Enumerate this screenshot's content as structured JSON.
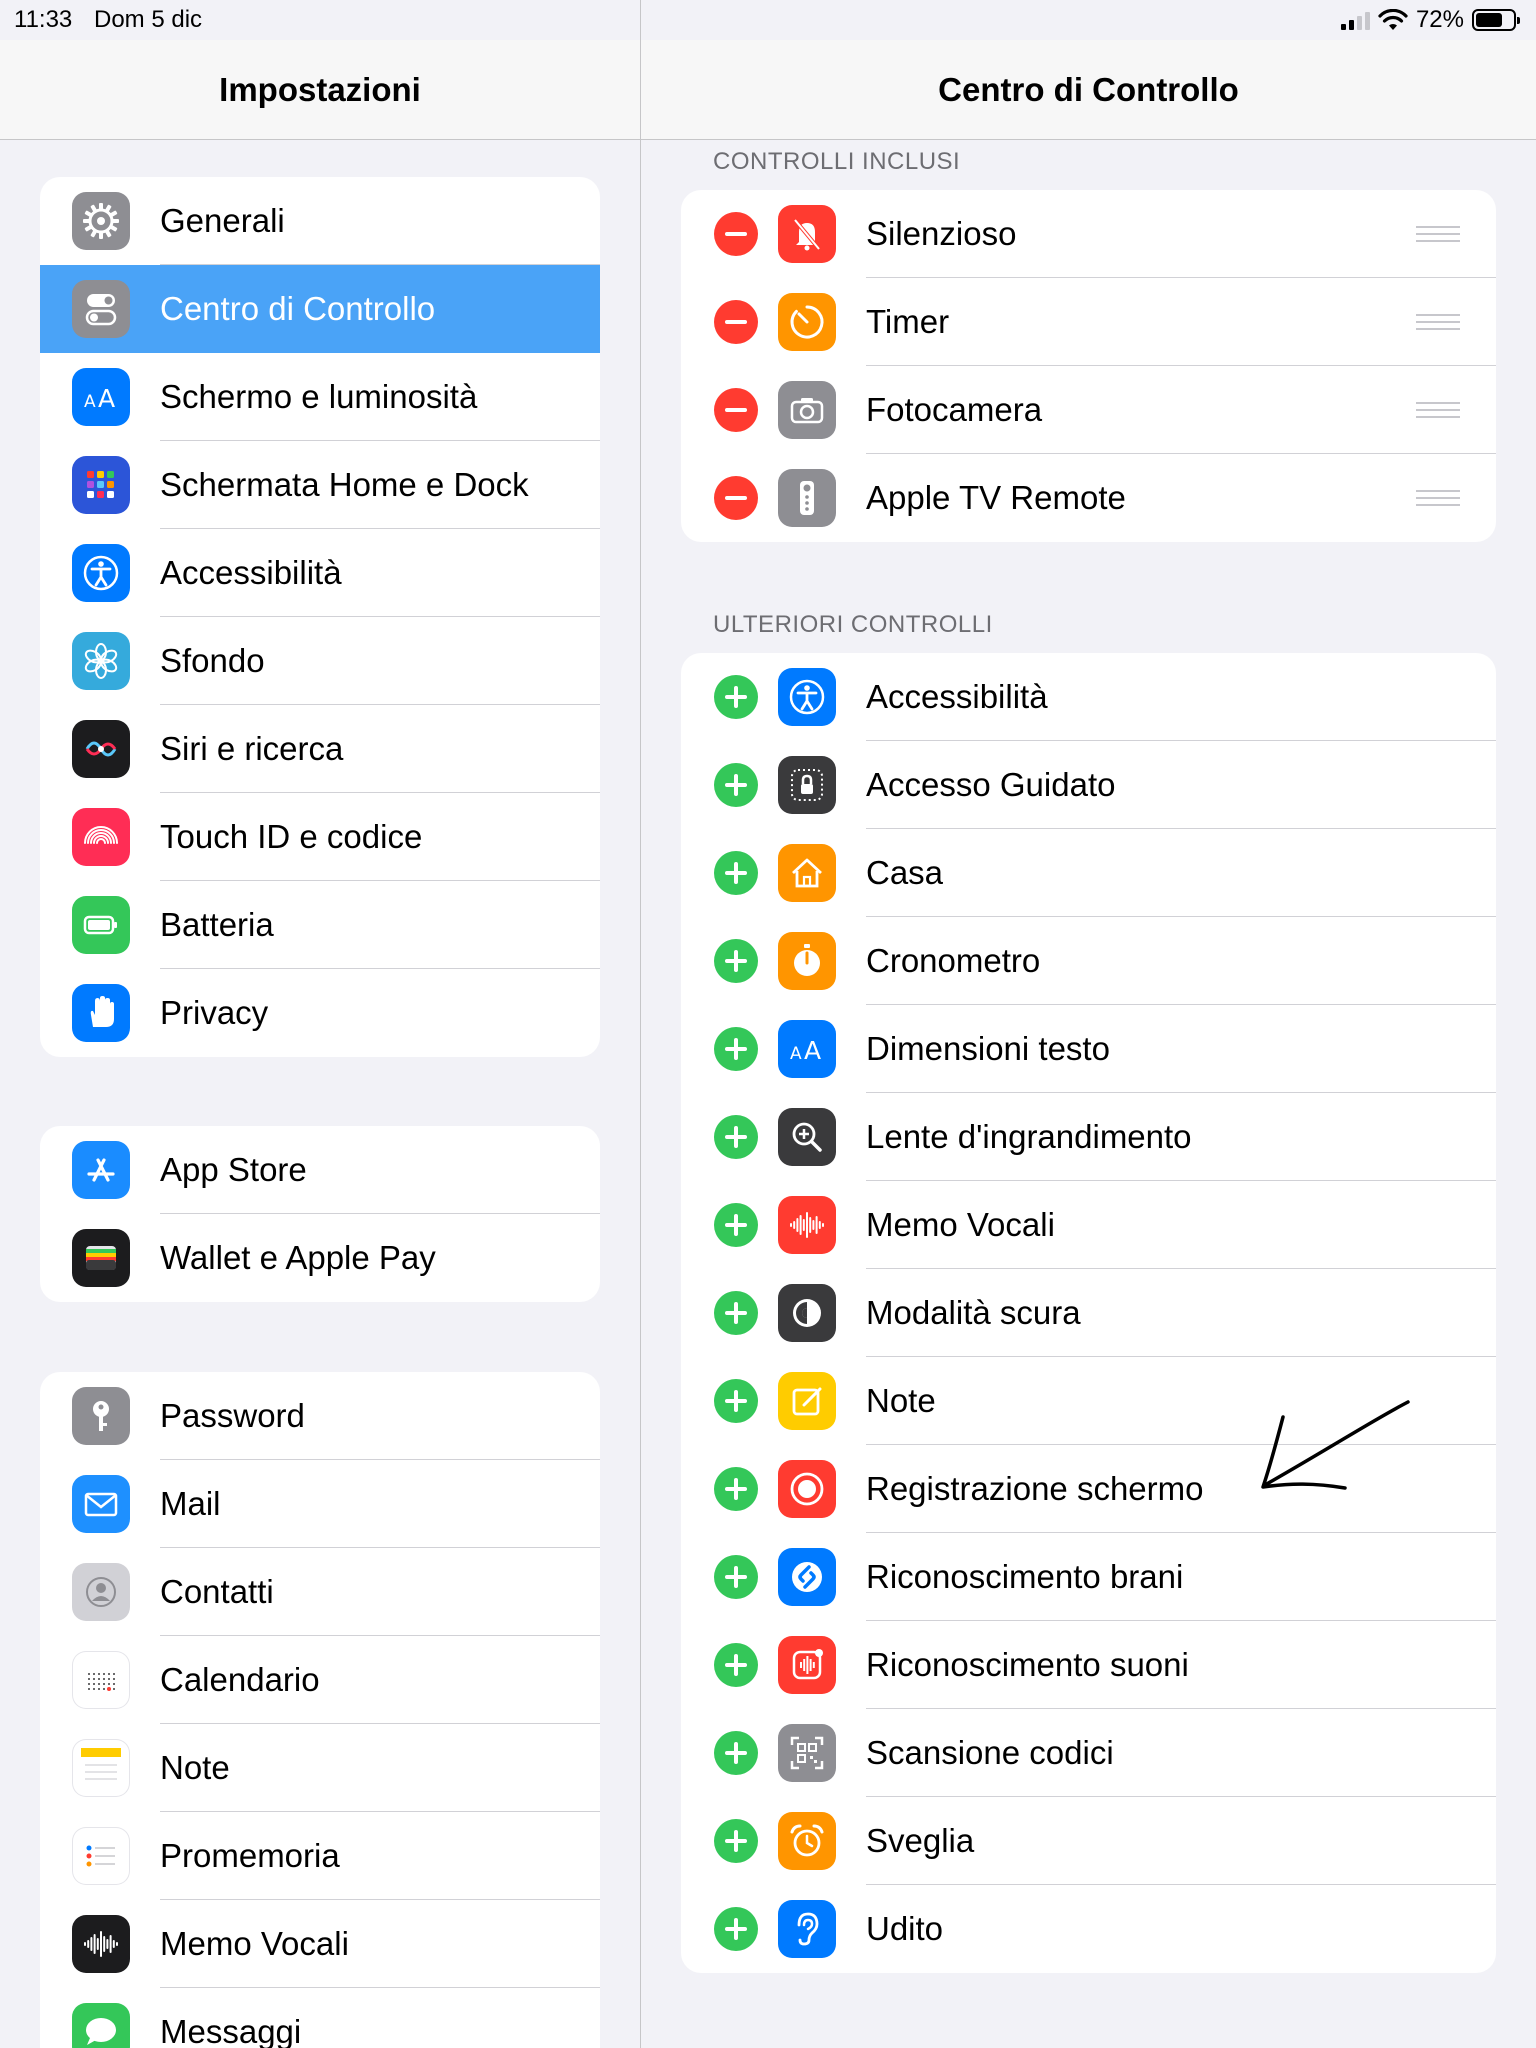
{
  "status": {
    "time": "11:33",
    "date": "Dom 5 dic",
    "battery": "72%",
    "battery_level": 0.72
  },
  "left_header": "Impostazioni",
  "right_header": "Centro di Controllo",
  "left_groups": [
    [
      {
        "label": "Generali",
        "icon": "gear-icon",
        "color": "#8e8e93"
      },
      {
        "label": "Centro di Controllo",
        "icon": "toggles-icon",
        "color": "#8e8e93",
        "selected": true
      },
      {
        "label": "Schermo e luminosità",
        "icon": "text-size-icon",
        "color": "#007aff"
      },
      {
        "label": "Schermata Home e Dock",
        "icon": "home-grid-icon",
        "color": "#2c55d8"
      },
      {
        "label": "Accessibilità",
        "icon": "accessibility-icon",
        "color": "#007aff"
      },
      {
        "label": "Sfondo",
        "icon": "flower-icon",
        "color": "#35aadc"
      },
      {
        "label": "Siri e ricerca",
        "icon": "siri-icon",
        "color": "#1c1c1e"
      },
      {
        "label": "Touch ID e codice",
        "icon": "fingerprint-icon",
        "color": "#ff2d55"
      },
      {
        "label": "Batteria",
        "icon": "battery-icon",
        "color": "#34c759"
      },
      {
        "label": "Privacy",
        "icon": "hand-icon",
        "color": "#007aff"
      }
    ],
    [
      {
        "label": "App Store",
        "icon": "app-store-icon",
        "color": "#1a8cff"
      },
      {
        "label": "Wallet e Apple Pay",
        "icon": "wallet-icon",
        "color": "#1c1c1e"
      }
    ],
    [
      {
        "label": "Password",
        "icon": "key-icon",
        "color": "#8e8e93"
      },
      {
        "label": "Mail",
        "icon": "envelope-icon",
        "color": "#1e90ff"
      },
      {
        "label": "Contatti",
        "icon": "contact-icon",
        "color": "#d1d1d6"
      },
      {
        "label": "Calendario",
        "icon": "calendar-icon",
        "color": "#ffffff"
      },
      {
        "label": "Note",
        "icon": "notes-icon",
        "color": "#ffffff"
      },
      {
        "label": "Promemoria",
        "icon": "reminders-icon",
        "color": "#ffffff"
      },
      {
        "label": "Memo Vocali",
        "icon": "waveform-icon",
        "color": "#1c1c1e"
      },
      {
        "label": "Messaggi",
        "icon": "message-icon",
        "color": "#34c759"
      }
    ]
  ],
  "included_section": "CONTROLLI INCLUSI",
  "included": [
    {
      "label": "Silenzioso",
      "icon": "bell-slash-icon",
      "color": "#ff3b30"
    },
    {
      "label": "Timer",
      "icon": "timer-icon",
      "color": "#ff9500"
    },
    {
      "label": "Fotocamera",
      "icon": "camera-icon",
      "color": "#8e8e93"
    },
    {
      "label": "Apple TV Remote",
      "icon": "remote-icon",
      "color": "#8e8e93"
    }
  ],
  "more_section": "ULTERIORI CONTROLLI",
  "more": [
    {
      "label": "Accessibilità",
      "icon": "accessibility-icon",
      "color": "#007aff"
    },
    {
      "label": "Accesso Guidato",
      "icon": "lock-icon",
      "color": "#3a3a3c"
    },
    {
      "label": "Casa",
      "icon": "house-icon",
      "color": "#ff9500"
    },
    {
      "label": "Cronometro",
      "icon": "stopwatch-icon",
      "color": "#ff9500"
    },
    {
      "label": "Dimensioni testo",
      "icon": "text-size-icon",
      "color": "#007aff"
    },
    {
      "label": "Lente d'ingrandimento",
      "icon": "magnifier-icon",
      "color": "#3a3a3c"
    },
    {
      "label": "Memo Vocali",
      "icon": "waveform-icon",
      "color": "#ff3b30"
    },
    {
      "label": "Modalità scura",
      "icon": "dark-mode-icon",
      "color": "#3a3a3c"
    },
    {
      "label": "Note",
      "icon": "note-edit-icon",
      "color": "#ffcc00"
    },
    {
      "label": "Registrazione schermo",
      "icon": "record-icon",
      "color": "#ff3b30"
    },
    {
      "label": "Riconoscimento brani",
      "icon": "shazam-icon",
      "color": "#007aff"
    },
    {
      "label": "Riconoscimento suoni",
      "icon": "sound-recognition-icon",
      "color": "#ff3b30"
    },
    {
      "label": "Scansione codici",
      "icon": "qr-code-icon",
      "color": "#8e8e93"
    },
    {
      "label": "Sveglia",
      "icon": "alarm-icon",
      "color": "#ff9500"
    },
    {
      "label": "Udito",
      "icon": "ear-icon",
      "color": "#007aff"
    }
  ]
}
